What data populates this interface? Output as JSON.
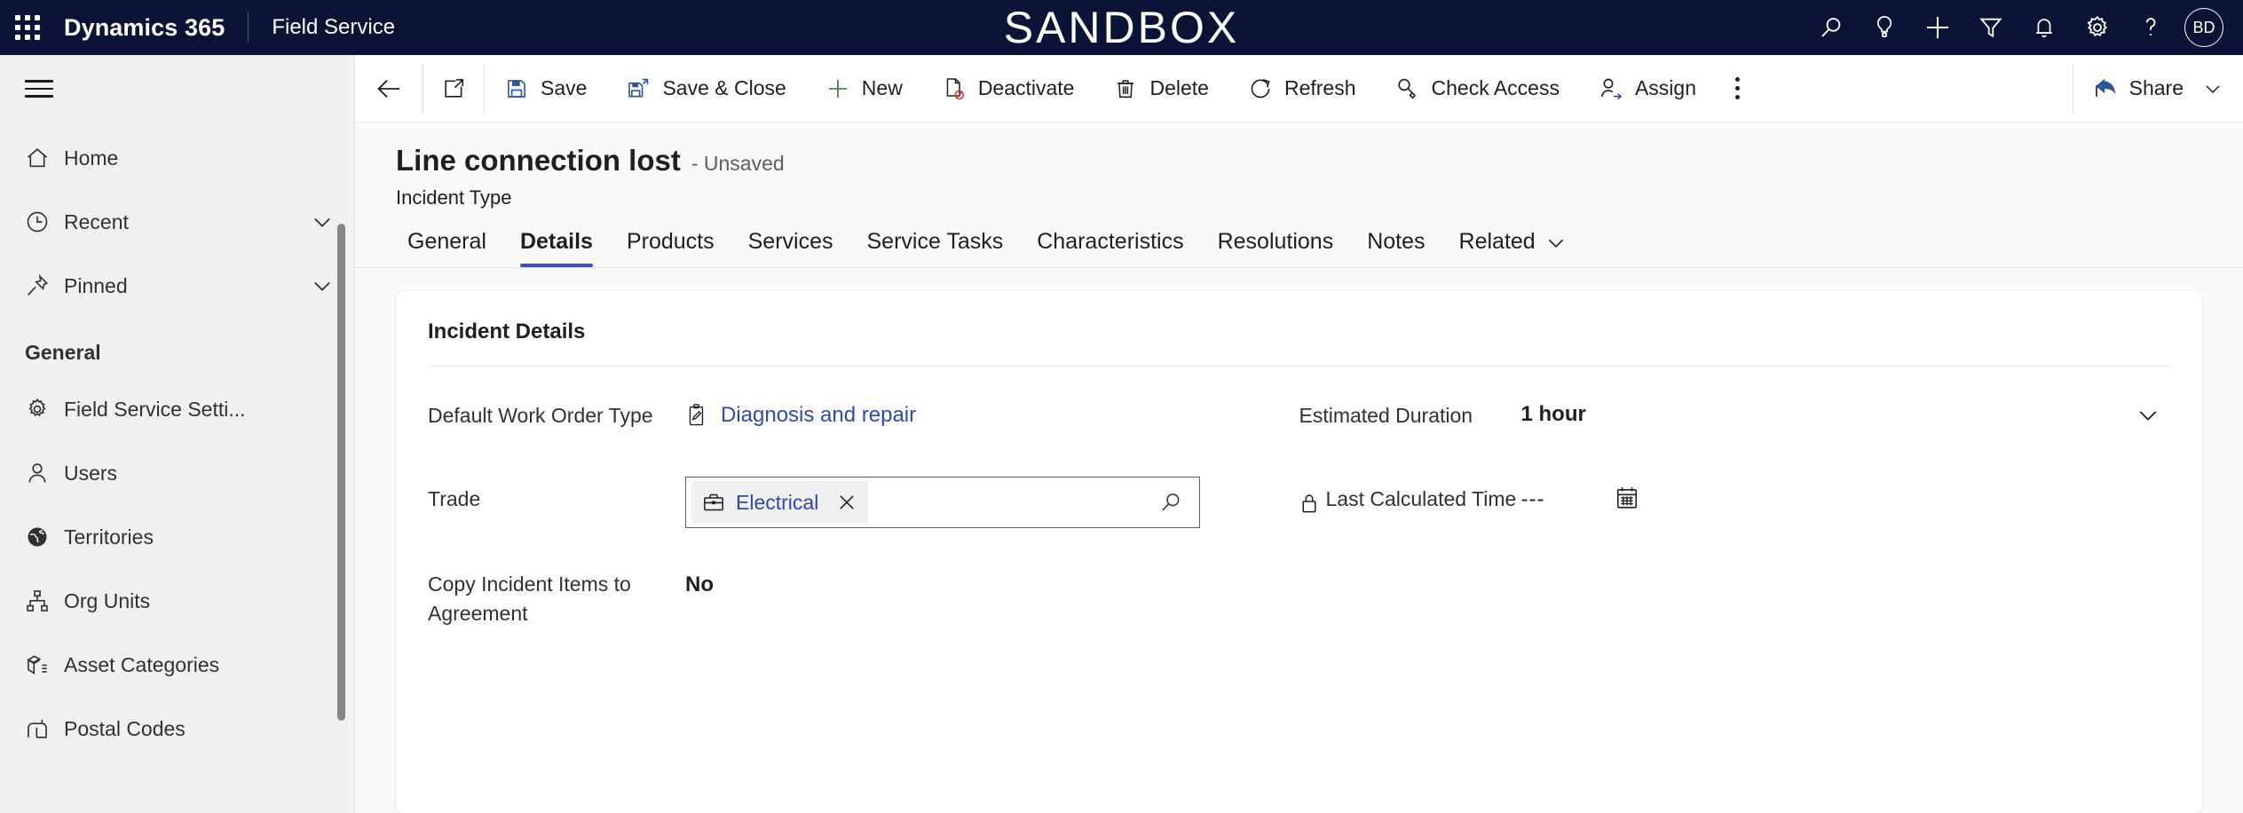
{
  "header": {
    "waffle_icon": "app-launcher-icon",
    "brand": "Dynamics 365",
    "app_name": "Field Service",
    "environment_banner": "SANDBOX",
    "icons": [
      {
        "name": "search-icon",
        "label": "Search"
      },
      {
        "name": "lightbulb-icon",
        "label": "Insights"
      },
      {
        "name": "plus-icon",
        "label": "Quick create"
      },
      {
        "name": "filter-icon",
        "label": "Filter"
      },
      {
        "name": "bell-icon",
        "label": "Notifications"
      },
      {
        "name": "gear-icon",
        "label": "Settings"
      },
      {
        "name": "question-icon",
        "label": "Help"
      }
    ],
    "avatar_initials": "BD",
    "accent_color": "#0b1437"
  },
  "sidebar": {
    "hamburger_icon": "hamburger-menu-icon",
    "top_items": [
      {
        "label": "Home",
        "icon": "home-icon",
        "chevron": false
      },
      {
        "label": "Recent",
        "icon": "clock-icon",
        "chevron": true
      },
      {
        "label": "Pinned",
        "icon": "pin-icon",
        "chevron": true
      }
    ],
    "group_label": "General",
    "group_items": [
      {
        "label": "Field Service Setti...",
        "icon": "gear-icon"
      },
      {
        "label": "Users",
        "icon": "person-icon"
      },
      {
        "label": "Territories",
        "icon": "globe-icon"
      },
      {
        "label": "Org Units",
        "icon": "org-chart-icon"
      },
      {
        "label": "Asset Categories",
        "icon": "asset-box-icon"
      },
      {
        "label": "Postal Codes",
        "icon": "mailbox-icon"
      }
    ]
  },
  "commandbar": {
    "back_icon": "back-arrow-icon",
    "popout_icon": "open-in-new-window-icon",
    "buttons": [
      {
        "label": "Save",
        "icon": "save-floppy-icon"
      },
      {
        "label": "Save & Close",
        "icon": "save-and-close-icon"
      },
      {
        "label": "New",
        "icon": "plus-icon"
      },
      {
        "label": "Deactivate",
        "icon": "deactivate-icon"
      },
      {
        "label": "Delete",
        "icon": "trash-icon"
      },
      {
        "label": "Refresh",
        "icon": "refresh-icon"
      },
      {
        "label": "Check Access",
        "icon": "key-icon"
      },
      {
        "label": "Assign",
        "icon": "assign-person-icon"
      }
    ],
    "overflow_icon": "more-options-icon",
    "share": {
      "label": "Share",
      "icon": "share-icon",
      "chevron_icon": "chevron-down-icon"
    }
  },
  "record": {
    "title": "Line connection lost",
    "status": "- Unsaved",
    "entity": "Incident Type"
  },
  "tabs": {
    "items": [
      {
        "label": "General",
        "active": false
      },
      {
        "label": "Details",
        "active": true
      },
      {
        "label": "Products",
        "active": false
      },
      {
        "label": "Services",
        "active": false
      },
      {
        "label": "Service Tasks",
        "active": false
      },
      {
        "label": "Characteristics",
        "active": false
      },
      {
        "label": "Resolutions",
        "active": false
      },
      {
        "label": "Notes",
        "active": false
      }
    ],
    "related_label": "Related",
    "related_chevron_icon": "chevron-down-icon"
  },
  "form": {
    "section_title": "Incident Details",
    "left_fields": [
      {
        "label": "Default Work Order Type",
        "type": "lookup-link",
        "value": "Diagnosis and repair",
        "icon": "work-order-type-icon",
        "link_color": "#2b4ab5"
      },
      {
        "label": "Trade",
        "type": "lookup-input",
        "token_value": "Electrical",
        "token_icon": "toolbox-icon",
        "remove_icon": "close-x-icon",
        "search_icon": "lookup-search-icon"
      },
      {
        "label": "Copy Incident Items to Agreement",
        "type": "text",
        "value": "No"
      }
    ],
    "right_fields": [
      {
        "label": "Estimated Duration",
        "type": "combobox",
        "value": "1 hour",
        "chevron_icon": "chevron-down-icon",
        "locked": false
      },
      {
        "label": "Last Calculated Time",
        "type": "datetime",
        "value": "---",
        "lock_icon": "lock-icon",
        "calendar_icon": "calendar-icon",
        "locked": true
      }
    ]
  }
}
